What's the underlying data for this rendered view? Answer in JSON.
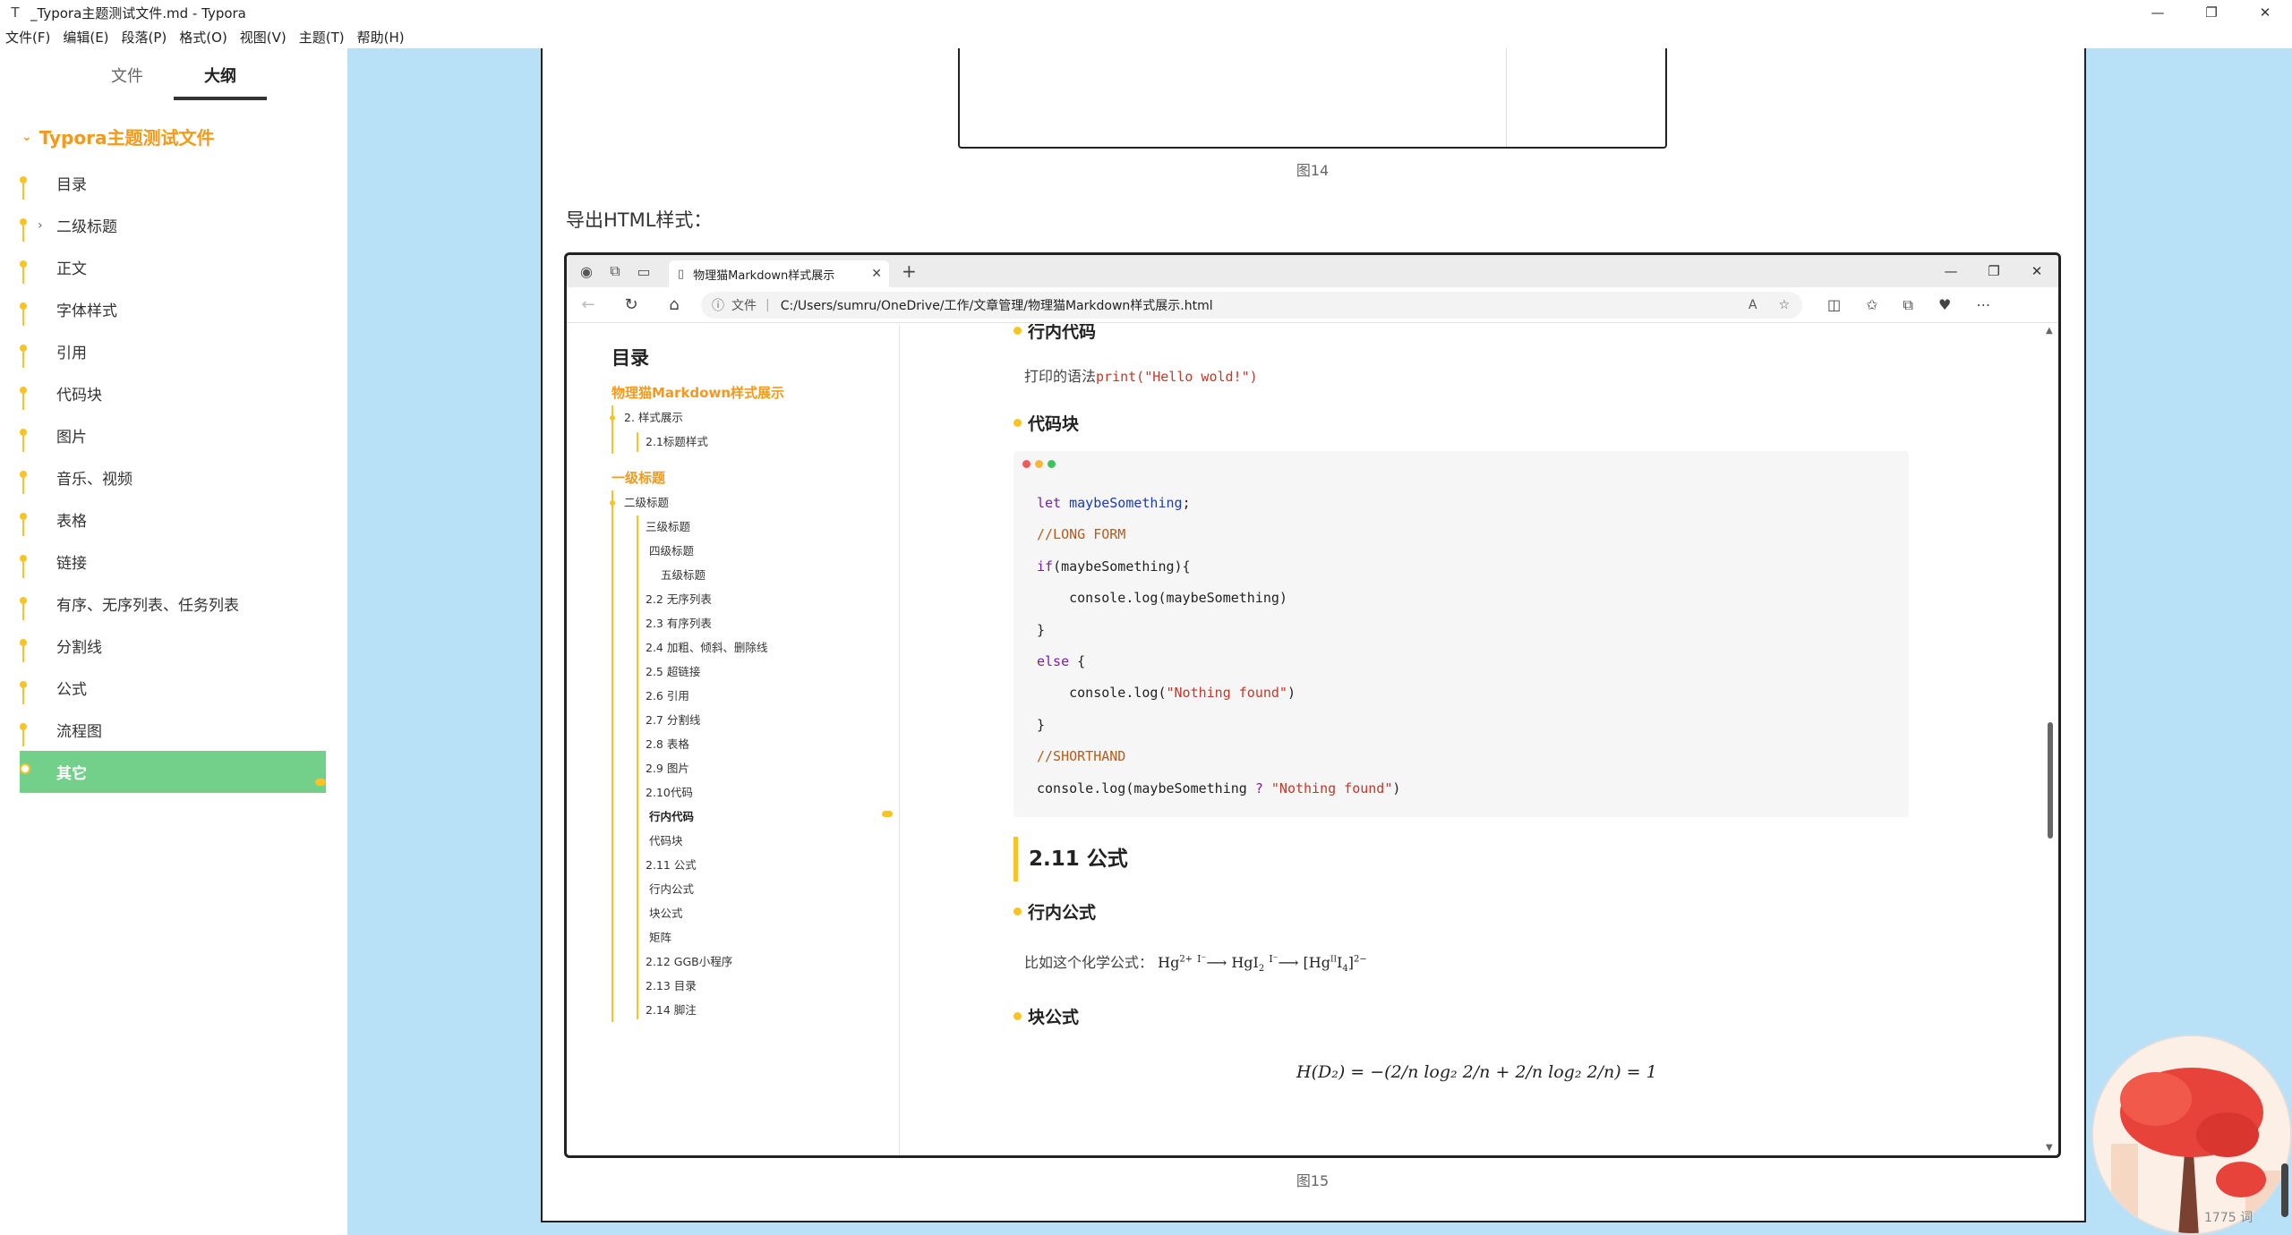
{
  "window": {
    "app_icon": "T",
    "title": "_Typora主题测试文件.md - Typora",
    "minimize": "—",
    "maximize": "❐",
    "close": "✕"
  },
  "menu": [
    "文件(F)",
    "编辑(E)",
    "段落(P)",
    "格式(O)",
    "视图(V)",
    "主题(T)",
    "帮助(H)"
  ],
  "sidebar": {
    "tabs": [
      {
        "label": "文件",
        "active": false
      },
      {
        "label": "大纲",
        "active": true
      }
    ],
    "root": "Typora主题测试文件",
    "items": [
      {
        "label": "目录"
      },
      {
        "label": "二级标题",
        "expandable": true
      },
      {
        "label": "正文"
      },
      {
        "label": "字体样式"
      },
      {
        "label": "引用"
      },
      {
        "label": "代码块"
      },
      {
        "label": "图片"
      },
      {
        "label": "音乐、视频"
      },
      {
        "label": "表格"
      },
      {
        "label": "链接"
      },
      {
        "label": "有序、无序列表、任务列表"
      },
      {
        "label": "分割线"
      },
      {
        "label": "公式"
      },
      {
        "label": "流程图"
      },
      {
        "label": "其它",
        "active": true
      }
    ],
    "footer_left": "<",
    "footer_code": "</>"
  },
  "document": {
    "fig14_caption": "图14",
    "export_label": "导出HTML样式：",
    "fig15_caption": "图15",
    "word_count": "1775 词"
  },
  "browser": {
    "tab_title": "物理猫Markdown样式展示",
    "tab_close": "✕",
    "new_tab": "+",
    "address_protocol": "文件",
    "address_url": "C:/Users/sumru/OneDrive/工作/文章管理/物理猫Markdown样式展示.html",
    "toc": {
      "title": "目录",
      "section1": "物理猫Markdown样式展示",
      "s1_items": [
        "2. 样式展示",
        "2.1标题样式"
      ],
      "section2": "一级标题",
      "s2_items": [
        {
          "label": "二级标题",
          "level": 1
        },
        {
          "label": "三级标题",
          "level": 2
        },
        {
          "label": "四级标题",
          "level": 3
        },
        {
          "label": "五级标题",
          "level": 4
        },
        {
          "label": "2.2 无序列表",
          "level": 2
        },
        {
          "label": "2.3 有序列表",
          "level": 2
        },
        {
          "label": "2.4 加粗、倾斜、删除线",
          "level": 2
        },
        {
          "label": "2.5 超链接",
          "level": 2
        },
        {
          "label": "2.6 引用",
          "level": 2
        },
        {
          "label": "2.7 分割线",
          "level": 2
        },
        {
          "label": "2.8 表格",
          "level": 2
        },
        {
          "label": "2.9 图片",
          "level": 2
        },
        {
          "label": "2.10代码",
          "level": 2
        },
        {
          "label": "行内代码",
          "level": 3,
          "current": true
        },
        {
          "label": "代码块",
          "level": 3
        },
        {
          "label": "2.11 公式",
          "level": 2
        },
        {
          "label": "行内公式",
          "level": 3
        },
        {
          "label": "块公式",
          "level": 3
        },
        {
          "label": "矩阵",
          "level": 3
        },
        {
          "label": "2.12 GGB小程序",
          "level": 2
        },
        {
          "label": "2.13 目录",
          "level": 2
        },
        {
          "label": "2.14 脚注",
          "level": 2
        }
      ]
    },
    "content": {
      "h_inline_code": "行内代码",
      "inline_code_prefix": "打印的语法",
      "inline_code": "print(\"Hello wold!\")",
      "h_code_block": "代码块",
      "code_lines": [
        [
          {
            "t": "let ",
            "c": "kw"
          },
          {
            "t": "maybeSomething",
            "c": "var"
          },
          {
            "t": ";",
            "c": ""
          }
        ],
        [
          {
            "t": "//LONG FORM",
            "c": "cm"
          }
        ],
        [
          {
            "t": "if",
            "c": "kw"
          },
          {
            "t": "(maybeSomething){",
            "c": ""
          }
        ],
        [
          {
            "t": "    console.log(maybeSomething)",
            "c": ""
          }
        ],
        [
          {
            "t": "}",
            "c": ""
          }
        ],
        [
          {
            "t": "else",
            "c": "kw"
          },
          {
            "t": " {",
            "c": ""
          }
        ],
        [
          {
            "t": "    console.log(",
            "c": ""
          },
          {
            "t": "\"Nothing found\"",
            "c": "str"
          },
          {
            "t": ")",
            "c": ""
          }
        ],
        [
          {
            "t": "}",
            "c": ""
          }
        ],
        [
          {
            "t": "//SHORTHAND",
            "c": "cm"
          }
        ],
        [
          {
            "t": "console.log(maybeSomething ",
            "c": ""
          },
          {
            "t": "?",
            "c": "kw"
          },
          {
            "t": " ",
            "c": ""
          },
          {
            "t": "\"Nothing found\"",
            "c": "str"
          },
          {
            "t": ")",
            "c": ""
          }
        ]
      ],
      "h_formula": "2.11 公式",
      "h_inline_formula": "行内公式",
      "inline_formula_prefix": "比如这个化学公式：",
      "h_block_formula": "块公式",
      "block_formula": "H(D₂) = −(2/n log₂ 2/n + 2/n log₂ 2/n) = 1"
    }
  },
  "colors": {
    "accent": "#f39a1c",
    "marker": "#f7c325",
    "active_bg": "#73d08b",
    "editor_bg": "#b8e0f7"
  }
}
